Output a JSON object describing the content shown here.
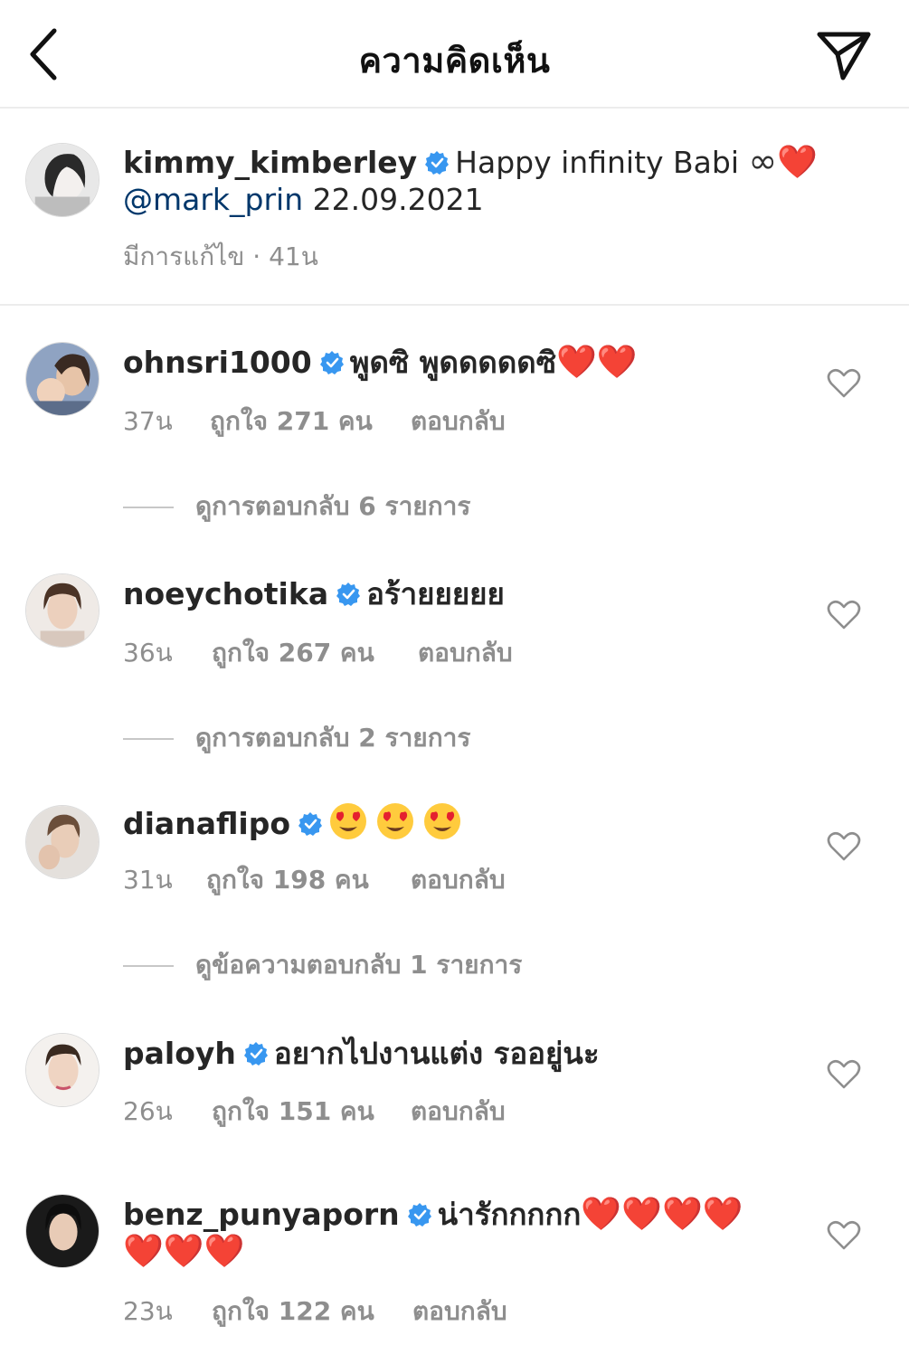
{
  "header": {
    "title": "ความคิดเห็น"
  },
  "caption": {
    "username": "kimmy_kimberley",
    "text": "Happy infinity Babi",
    "infinity": "∞",
    "heart": "❤️",
    "mention": "@mark_prin",
    "date": "22.09.2021",
    "meta": "มีการแก้ไข · 41น"
  },
  "comments": [
    {
      "username": "ohnsri1000",
      "text": "พูดซิ พูดดดดดซิ",
      "hearts": "❤️❤️",
      "time": "37น",
      "likes": "ถูกใจ 271 คน",
      "reply": "ตอบกลับ",
      "view_replies": "ดูการตอบกลับ 6 รายการ"
    },
    {
      "username": "noeychotika",
      "text": "อร้ายยยยย",
      "time": "36น",
      "likes": "ถูกใจ 267 คน",
      "reply": "ตอบกลับ",
      "view_replies": "ดูการตอบกลับ 2 รายการ"
    },
    {
      "username": "dianaflipo",
      "text": "",
      "emoji": "😍😍😍",
      "time": "31น",
      "likes": "ถูกใจ 198 คน",
      "reply": "ตอบกลับ",
      "view_replies": "ดูข้อความตอบกลับ 1 รายการ"
    },
    {
      "username": "paloyh",
      "text": "อยากไปงานแต่ง รออยู่นะ",
      "time": "26น",
      "likes": "ถูกใจ 151 คน",
      "reply": "ตอบกลับ"
    },
    {
      "username": "benz_punyaporn",
      "text": "น่ารักกกกก",
      "hearts_line1": "❤️❤️❤️❤️",
      "hearts_line2": "❤️❤️❤️",
      "time": "23น",
      "likes": "ถูกใจ 122 คน",
      "reply": "ตอบกลับ"
    }
  ],
  "icons": {
    "back": "chevron-left-icon",
    "send": "paper-plane-icon",
    "like": "heart-outline-icon",
    "verified": "verified-badge-icon"
  },
  "colors": {
    "verified": "#3897f0",
    "mention": "#00376b",
    "muted": "#8e8e8e",
    "heart": "#e0262d"
  }
}
